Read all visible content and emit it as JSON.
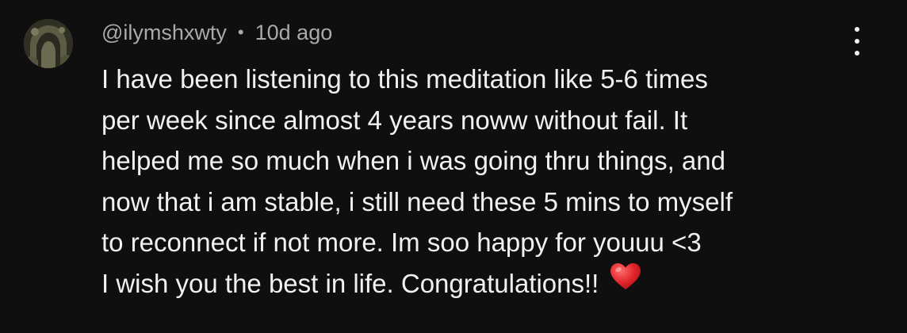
{
  "comment": {
    "username": "@ilymshxwty",
    "separator": "•",
    "timestamp": "10d ago",
    "avatar_icon": "user-avatar",
    "menu_icon": "more-vert-icon",
    "body_lines": [
      "I have been listening to this meditation like 5-6 times",
      "per week since almost 4 years noww without fail. It",
      "helped me so much when i was going thru things, and",
      "now that i am stable, i still need these 5 mins to myself",
      "to reconnect if not more. Im soo happy for youuu <3",
      "I wish you the best in life. Congratulations!!"
    ],
    "emoji": "red-heart",
    "colors": {
      "background": "#0f0f0f",
      "text": "#f1f1f1",
      "meta": "#aaaaaa",
      "heart": "#e0242b"
    }
  }
}
